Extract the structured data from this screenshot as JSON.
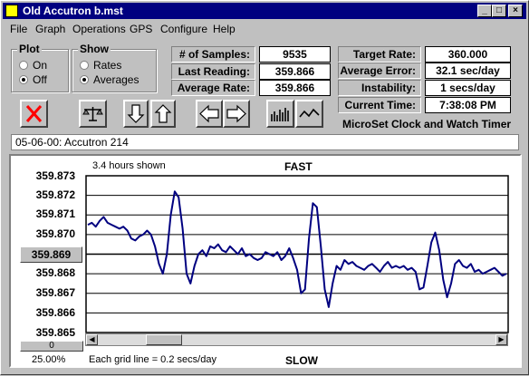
{
  "window": {
    "title": "Old Accutron b.mst"
  },
  "menu": [
    "File",
    "Graph",
    "Operations",
    "GPS",
    "Configure",
    "Help"
  ],
  "plot": {
    "label": "Plot",
    "on": "On",
    "off": "Off",
    "selected": "Off"
  },
  "show": {
    "label": "Show",
    "rates": "Rates",
    "averages": "Averages",
    "selected": "Averages"
  },
  "stats_left": [
    {
      "label": "# of Samples:",
      "value": "9535"
    },
    {
      "label": "Last Reading:",
      "value": "359.866"
    },
    {
      "label": "Average Rate:",
      "value": "359.866"
    }
  ],
  "stats_right": [
    {
      "label": "Target Rate:",
      "value": "360.000"
    },
    {
      "label": "Average Error:",
      "value": "32.1 sec/day"
    },
    {
      "label": "Instability:",
      "value": "1 secs/day"
    },
    {
      "label": "Current Time:",
      "value": "7:38:08 PM"
    }
  ],
  "toolbar": [
    "close-x-icon",
    "scales-icon",
    "arrow-down-icon",
    "arrow-up-icon",
    "arrow-left-icon",
    "arrow-right-icon",
    "bar-graph-icon",
    "wave-graph-icon"
  ],
  "brand": "MicroSet Clock and Watch Timer",
  "notes": "05-06-00: Accutron 214",
  "chart": {
    "hours_shown": "3.4 hours shown",
    "fast_label": "FAST",
    "slow_label": "SLOW",
    "grid_note": "Each grid line = 0.2 secs/day",
    "zoom_pct": "25.00%",
    "bottom_button": "0",
    "y_labels": [
      "359.873",
      "359.872",
      "359.871",
      "359.870",
      "359.869",
      "359.868",
      "359.867",
      "359.866",
      "359.865"
    ],
    "center_label": "359.869",
    "colors": {
      "line": "#000080",
      "grid": "#000000"
    }
  },
  "chart_data": {
    "type": "line",
    "ylim": [
      359.865,
      359.873
    ],
    "series": [
      {
        "values": [
          359.8705,
          359.8706,
          359.8704,
          359.8707,
          359.8709,
          359.8706,
          359.8705,
          359.8704,
          359.8703,
          359.8704,
          359.8702,
          359.8698,
          359.8697,
          359.8699,
          359.87,
          359.8702,
          359.87,
          359.8694,
          359.8685,
          359.868,
          359.869,
          359.871,
          359.8722,
          359.8719,
          359.8703,
          359.868,
          359.8675,
          359.8684,
          359.869,
          359.8692,
          359.8689,
          359.8694,
          359.8693,
          359.8695,
          359.8692,
          359.8691,
          359.8694,
          359.8692,
          359.869,
          359.8693,
          359.8689,
          359.869,
          359.8688,
          359.8687,
          359.8688,
          359.8691,
          359.869,
          359.8689,
          359.8691,
          359.8687,
          359.8689,
          359.8693,
          359.8688,
          359.8682,
          359.867,
          359.8672,
          359.8698,
          359.8716,
          359.8714,
          359.8694,
          359.8672,
          359.8663,
          359.8675,
          359.8684,
          359.8682,
          359.8687,
          359.8685,
          359.8686,
          359.8684,
          359.8683,
          359.8682,
          359.8684,
          359.8685,
          359.8683,
          359.8681,
          359.8684,
          359.8686,
          359.8683,
          359.8684,
          359.8683,
          359.8684,
          359.8682,
          359.8683,
          359.8681,
          359.8672,
          359.8673,
          359.8684,
          359.8696,
          359.8701,
          359.8692,
          359.8677,
          359.8668,
          359.8675,
          359.8685,
          359.8687,
          359.8684,
          359.8683,
          359.8685,
          359.8681,
          359.8682,
          359.868,
          359.8681,
          359.8682,
          359.8683,
          359.8681,
          359.8679,
          359.868
        ]
      }
    ]
  }
}
